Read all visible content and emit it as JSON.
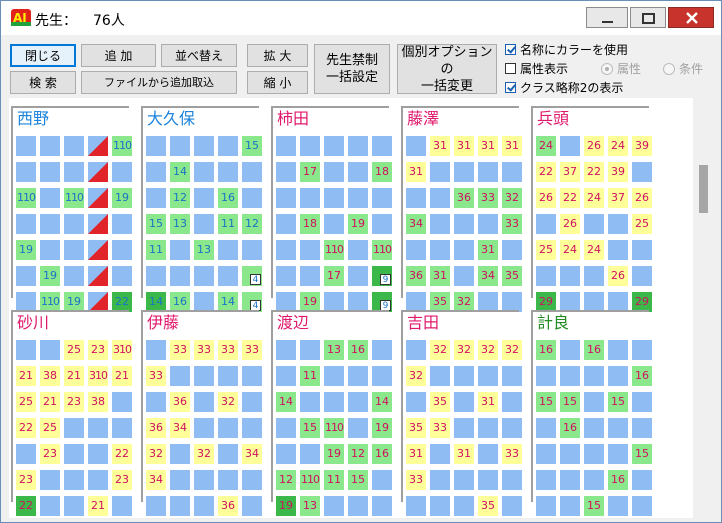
{
  "title": {
    "label": "先生：",
    "count": "76人"
  },
  "toolbar": {
    "close": "閉じる",
    "search": "検 索",
    "add": "追 加",
    "import": "ファイルから追加取込",
    "sort": "並べ替え",
    "zoom_in": "拡 大",
    "zoom_out": "縮 小",
    "bulk_ban_1": "先生禁制",
    "bulk_ban_2": "一括設定",
    "bulk_opt_1": "個別オプションの",
    "bulk_opt_2": "一括変更"
  },
  "options": {
    "color_name": "名称にカラーを使用",
    "attr_display": "属性表示",
    "class_abbr": "クラス略称2の表示",
    "radio_attr": "属性",
    "radio_cond": "条件"
  },
  "colors": {
    "empty": "#8fbcf2",
    "green": "#8be78b",
    "yellow": "#ffff9a",
    "dark": "#3cb84a",
    "red": "#e0242a",
    "name_blue": "#1c84dc",
    "name_pink": "#e0186c",
    "name_green": "#228b22",
    "text_blue": "#1a73c8",
    "text_pink": "#d01060"
  },
  "teachers": [
    {
      "name": "西野",
      "color": "blue",
      "rows": [
        [
          "e",
          "e",
          "e",
          "R",
          "g:110"
        ],
        [
          "e",
          "e",
          "e",
          "R",
          "e"
        ],
        [
          "g:110",
          "e",
          "g:110",
          "R",
          "g:19"
        ],
        [
          "e",
          "e",
          "e",
          "R",
          "e"
        ],
        [
          "g:19",
          "e",
          "e",
          "R",
          "e"
        ],
        [
          "e",
          "g:19",
          "e",
          "R",
          "e"
        ],
        [
          "e",
          "g:110",
          "g:19",
          "R",
          "D:22"
        ]
      ]
    },
    {
      "name": "大久保",
      "color": "blue",
      "rows": [
        [
          "e",
          "e",
          "e",
          "e",
          "g:15"
        ],
        [
          "e",
          "g:14",
          "e",
          "e",
          "e"
        ],
        [
          "e",
          "g:12",
          "e",
          "g:16",
          "e"
        ],
        [
          "g:15",
          "g:13",
          "e",
          "g:11",
          "g:12"
        ],
        [
          "g:11",
          "e",
          "g:13",
          "e",
          "e"
        ],
        [
          "e",
          "e",
          "e",
          "e",
          "W:4"
        ],
        [
          "D:14",
          "g:16",
          "e",
          "g:14",
          "W:4"
        ]
      ]
    },
    {
      "name": "柿田",
      "color": "pink",
      "rows": [
        [
          "e",
          "e",
          "e",
          "e",
          "e"
        ],
        [
          "e",
          "g:17",
          "e",
          "e",
          "g:18"
        ],
        [
          "e",
          "e",
          "e",
          "e",
          "e"
        ],
        [
          "e",
          "g:18",
          "e",
          "g:19",
          "e"
        ],
        [
          "e",
          "e",
          "g:110",
          "e",
          "g:110"
        ],
        [
          "e",
          "e",
          "g:17",
          "e",
          "K:9"
        ],
        [
          "e",
          "g:19",
          "e",
          "e",
          "K:9"
        ]
      ]
    },
    {
      "name": "藤澤",
      "color": "pink",
      "rows": [
        [
          "e",
          "y:31",
          "y:31",
          "y:31",
          "y:31"
        ],
        [
          "y:31",
          "e",
          "e",
          "e",
          "e"
        ],
        [
          "e",
          "e",
          "g:36",
          "g:33",
          "g:32"
        ],
        [
          "g:34",
          "e",
          "e",
          "e",
          "g:33"
        ],
        [
          "e",
          "e",
          "e",
          "g:31",
          "e"
        ],
        [
          "g:36",
          "g:31",
          "e",
          "g:34",
          "g:35"
        ],
        [
          "e",
          "g:35",
          "g:32",
          "e",
          "e"
        ]
      ]
    },
    {
      "name": "兵頭",
      "color": "pink",
      "rows": [
        [
          "g:24",
          "e",
          "y:26",
          "y:24",
          "y:39"
        ],
        [
          "y:22",
          "y:37",
          "y:22",
          "y:39",
          "e"
        ],
        [
          "y:26",
          "y:22",
          "y:24",
          "y:37",
          "y:26"
        ],
        [
          "e",
          "y:26",
          "e",
          "e",
          "y:25"
        ],
        [
          "y:25",
          "y:24",
          "y:24",
          "e",
          "e"
        ],
        [
          "e",
          "e",
          "e",
          "y:26",
          "e"
        ],
        [
          "D:29",
          "e",
          "e",
          "e",
          "D:29"
        ]
      ]
    },
    {
      "name": "砂川",
      "color": "pink",
      "rows": [
        [
          "e",
          "e",
          "y:25",
          "y:23",
          "y:310"
        ],
        [
          "y:21",
          "y:38",
          "y:21",
          "y:310",
          "y:21"
        ],
        [
          "y:25",
          "y:21",
          "y:23",
          "y:38",
          "e"
        ],
        [
          "y:22",
          "y:25",
          "e",
          "e",
          "e"
        ],
        [
          "e",
          "y:23",
          "e",
          "e",
          "y:22"
        ],
        [
          "y:23",
          "e",
          "e",
          "e",
          "y:23"
        ],
        [
          "D:22",
          "e",
          "e",
          "y:21",
          "e"
        ]
      ]
    },
    {
      "name": "伊藤",
      "color": "pink",
      "rows": [
        [
          "e",
          "y:33",
          "y:33",
          "y:33",
          "y:33"
        ],
        [
          "y:33",
          "e",
          "e",
          "e",
          "e"
        ],
        [
          "e",
          "y:36",
          "e",
          "y:32",
          "e"
        ],
        [
          "y:36",
          "y:34",
          "e",
          "e",
          "e"
        ],
        [
          "y:32",
          "e",
          "y:32",
          "e",
          "y:34"
        ],
        [
          "y:34",
          "e",
          "e",
          "e",
          "e"
        ],
        [
          "e",
          "e",
          "e",
          "y:36",
          "e"
        ]
      ]
    },
    {
      "name": "渡辺",
      "color": "pink",
      "rows": [
        [
          "e",
          "e",
          "g:13",
          "g:16",
          "e"
        ],
        [
          "e",
          "g:11",
          "e",
          "e",
          "e"
        ],
        [
          "g:14",
          "e",
          "e",
          "e",
          "g:14"
        ],
        [
          "e",
          "g:15",
          "g:110",
          "e",
          "g:19"
        ],
        [
          "e",
          "e",
          "g:19",
          "g:12",
          "g:16"
        ],
        [
          "g:12",
          "g:110",
          "g:11",
          "g:15",
          "e"
        ],
        [
          "D:19",
          "g:13",
          "e",
          "e",
          "e"
        ]
      ]
    },
    {
      "name": "吉田",
      "color": "pink",
      "rows": [
        [
          "e",
          "y:32",
          "y:32",
          "y:32",
          "y:32"
        ],
        [
          "y:32",
          "e",
          "e",
          "e",
          "e"
        ],
        [
          "e",
          "y:35",
          "e",
          "y:31",
          "e"
        ],
        [
          "y:35",
          "y:33",
          "e",
          "e",
          "e"
        ],
        [
          "y:31",
          "e",
          "y:31",
          "e",
          "y:33"
        ],
        [
          "y:33",
          "e",
          "e",
          "e",
          "e"
        ],
        [
          "e",
          "e",
          "e",
          "y:35",
          "e"
        ]
      ]
    },
    {
      "name": "計良",
      "color": "green",
      "rows": [
        [
          "g:16",
          "e",
          "g:16",
          "e",
          "e"
        ],
        [
          "e",
          "e",
          "e",
          "e",
          "g:16"
        ],
        [
          "g:15",
          "g:15",
          "e",
          "g:15",
          "e"
        ],
        [
          "e",
          "g:16",
          "e",
          "e",
          "e"
        ],
        [
          "e",
          "e",
          "e",
          "e",
          "g:15"
        ],
        [
          "e",
          "e",
          "e",
          "g:16",
          "e"
        ],
        [
          "e",
          "e",
          "g:15",
          "e",
          "e"
        ]
      ]
    }
  ]
}
